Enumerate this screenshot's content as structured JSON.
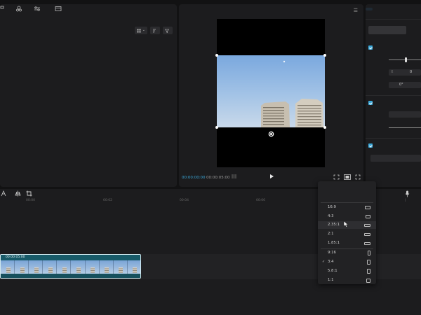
{
  "media_panel": {
    "tabs": [
      {
        "label": "",
        "icon": "media-icon"
      },
      {
        "label": "",
        "icon": "audio-icon"
      },
      {
        "label": "",
        "icon": "adjust-icon"
      },
      {
        "label": "",
        "icon": "folder-icon"
      }
    ],
    "tools": [
      {
        "label": "",
        "icon": "grid-icon"
      },
      {
        "label": "",
        "icon": "sort-icon"
      },
      {
        "label": "",
        "icon": "filter-icon"
      }
    ]
  },
  "player": {
    "title": "",
    "current_time": "00:00:00:00",
    "total_time": "00:00:05:00"
  },
  "inspector": {
    "tabs": [
      {
        "label": "",
        "active": true
      },
      {
        "label": "",
        "active": false
      },
      {
        "label": "",
        "active": false
      }
    ],
    "sub_tab": "",
    "position_size": {
      "title": "",
      "scale_label": "",
      "position_label": "",
      "x_label": "X",
      "x_value": "0",
      "rotate_label": "",
      "rotate_value": "0°"
    },
    "blend": {
      "title": "",
      "mode_label": "",
      "mode_value": "",
      "opacity_label": ""
    },
    "background": {
      "title": "",
      "value": ""
    }
  },
  "timeline": {
    "ticks": [
      "00:00",
      "00:02",
      "00:04",
      "00:06"
    ],
    "clip_duration": "00:00:05:00"
  },
  "ratio_menu": {
    "items": [
      {
        "label": "",
        "icon": "none",
        "selected": false
      },
      {
        "label": "",
        "icon": "none",
        "selected": false
      },
      {
        "label": "16:9",
        "icon": "landscape-wide",
        "selected": false
      },
      {
        "label": "4:3",
        "icon": "landscape",
        "selected": false
      },
      {
        "label": "2.35:1",
        "icon": "cinema",
        "selected": false
      },
      {
        "label": "2:1",
        "icon": "cinema",
        "selected": false
      },
      {
        "label": "1.85:1",
        "icon": "cinema",
        "selected": false
      },
      {
        "label": "9:16",
        "icon": "portrait-tall",
        "selected": false
      },
      {
        "label": "3:4",
        "icon": "portrait",
        "selected": true
      },
      {
        "label": "5.8:1",
        "icon": "portrait",
        "selected": false
      },
      {
        "label": "1:1",
        "icon": "square",
        "selected": false
      }
    ]
  },
  "colors": {
    "accent": "#3aa7d8",
    "panel": "#1c1c1e",
    "clip": "#1d5e6e"
  }
}
